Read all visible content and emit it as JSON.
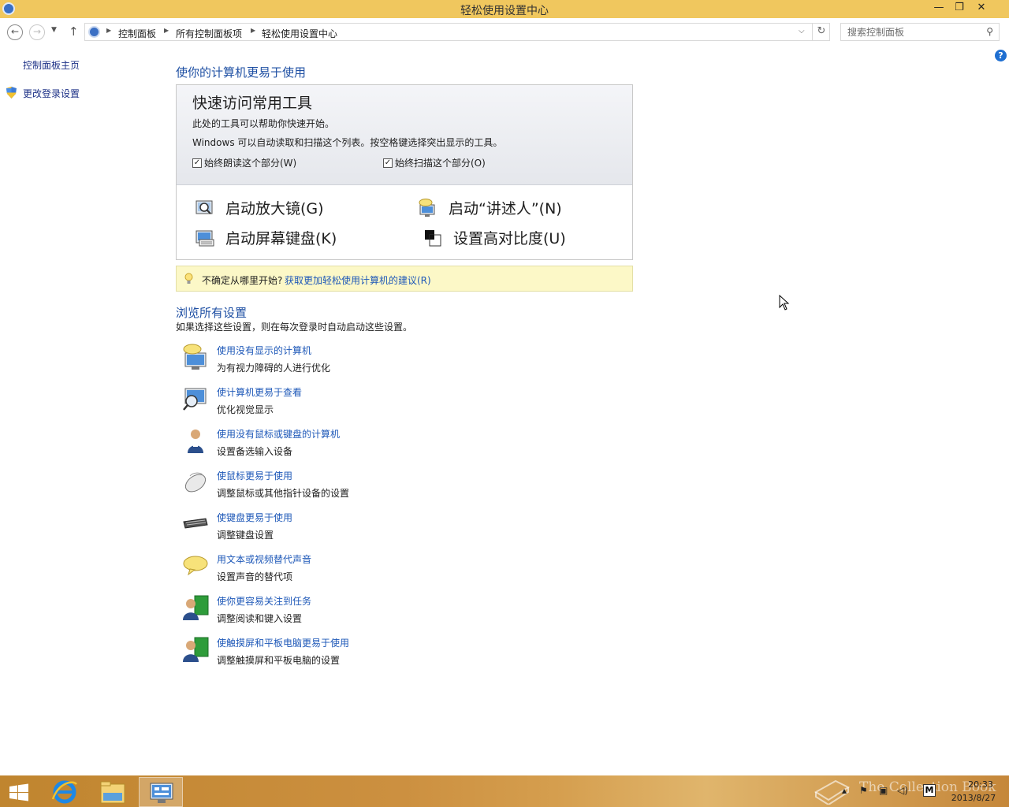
{
  "window": {
    "title": "轻松使用设置中心",
    "minimize": "—",
    "maximize": "❐",
    "close": "✕"
  },
  "address": {
    "crumbs": [
      "控制面板",
      "所有控制面板项",
      "轻松使用设置中心"
    ],
    "search_placeholder": "搜索控制面板"
  },
  "sidebar": {
    "home": "控制面板主页",
    "login_settings": "更改登录设置"
  },
  "main": {
    "title": "使你的计算机更易于使用",
    "quick": {
      "title": "快速访问常用工具",
      "line1": "此处的工具可以帮助你快速开始。",
      "line2": "Windows 可以自动读取和扫描这个列表。按空格键选择突出显示的工具。",
      "check_read": "始终朗读这个部分(W)",
      "check_scan": "始终扫描这个部分(O)",
      "check_read_checked": true,
      "check_scan_checked": true,
      "tools": {
        "magnifier": "启动放大镜(G)",
        "narrator": "启动“讲述人”(N)",
        "keyboard": "启动屏幕键盘(K)",
        "contrast": "设置高对比度(U)"
      }
    },
    "tip": {
      "text": "不确定从哪里开始?",
      "link": "获取更加轻松使用计算机的建议(R)"
    },
    "browse": {
      "title": "浏览所有设置",
      "subtitle": "如果选择这些设置，则在每次登录时自动启动这些设置。",
      "items": [
        {
          "title": "使用没有显示的计算机",
          "desc": "为有视力障碍的人进行优化",
          "icon": "monitor-speech-icon"
        },
        {
          "title": "使计算机更易于查看",
          "desc": "优化视觉显示",
          "icon": "monitor-magnifier-icon"
        },
        {
          "title": "使用没有鼠标或键盘的计算机",
          "desc": "设置备选输入设备",
          "icon": "person-icon"
        },
        {
          "title": "使鼠标更易于使用",
          "desc": "调整鼠标或其他指针设备的设置",
          "icon": "mouse-icon"
        },
        {
          "title": "使键盘更易于使用",
          "desc": "调整键盘设置",
          "icon": "keyboard-icon"
        },
        {
          "title": "用文本或视频替代声音",
          "desc": "设置声音的替代项",
          "icon": "speech-bubble-icon"
        },
        {
          "title": "使你更容易关注到任务",
          "desc": "调整阅读和键入设置",
          "icon": "user-task-icon"
        },
        {
          "title": "使触摸屏和平板电脑更易于使用",
          "desc": "调整触摸屏和平板电脑的设置",
          "icon": "user-touch-icon"
        }
      ]
    }
  },
  "taskbar": {
    "time": "20:33",
    "date": "2013/8/27",
    "ime": "M",
    "watermark": "The Collection Book"
  }
}
